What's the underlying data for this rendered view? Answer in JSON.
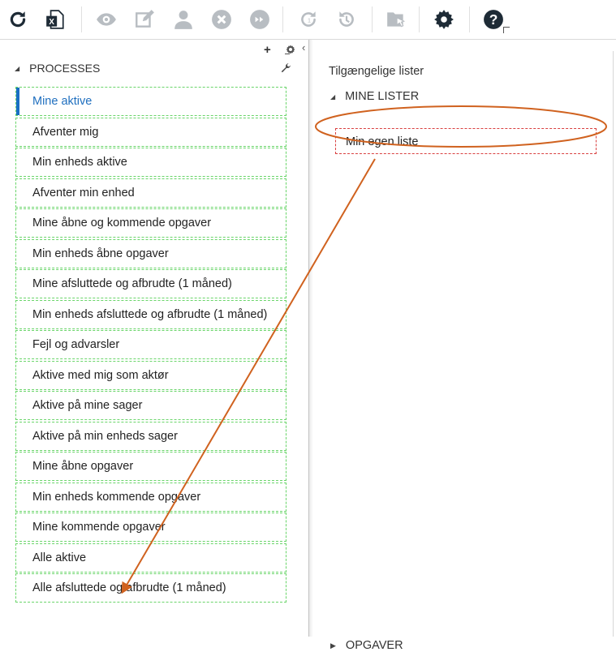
{
  "toolbar": {
    "icons": [
      {
        "name": "refresh-icon",
        "enabled": true
      },
      {
        "name": "excel-export-icon",
        "enabled": true
      },
      {
        "name": "view-icon",
        "enabled": false
      },
      {
        "name": "edit-icon",
        "enabled": false
      },
      {
        "name": "user-icon",
        "enabled": false
      },
      {
        "name": "cancel-icon",
        "enabled": false
      },
      {
        "name": "skip-icon",
        "enabled": false
      },
      {
        "name": "restart-icon",
        "enabled": false
      },
      {
        "name": "history-icon",
        "enabled": false
      },
      {
        "name": "move-document-icon",
        "enabled": false
      },
      {
        "name": "gear-icon",
        "enabled": true
      },
      {
        "name": "help-icon",
        "enabled": true
      }
    ],
    "colors": {
      "enabled": "#1e2b36",
      "disabled": "#b8bdc2"
    }
  },
  "left_panel": {
    "section_label": "PROCESSES",
    "items": [
      {
        "label": "Mine aktive",
        "active": true
      },
      {
        "label": "Afventer mig"
      },
      {
        "label": "Min enheds aktive"
      },
      {
        "label": "Afventer min enhed"
      },
      {
        "label": "Mine åbne og kommende opgaver"
      },
      {
        "label": "Min enheds åbne opgaver"
      },
      {
        "label": "Mine afsluttede og afbrudte (1 måned)"
      },
      {
        "label": "Min enheds afsluttede og afbrudte (1 måned)"
      },
      {
        "label": "Fejl og advarsler"
      },
      {
        "label": "Aktive med mig som aktør"
      },
      {
        "label": "Aktive på mine sager"
      },
      {
        "label": "Aktive på min enheds sager"
      },
      {
        "label": "Mine åbne opgaver"
      },
      {
        "label": "Min enheds kommende opgaver"
      },
      {
        "label": "Mine kommende opgaver"
      },
      {
        "label": "Alle aktive"
      },
      {
        "label": "Alle afsluttede og afbrudte (1 måned)"
      }
    ]
  },
  "right_panel": {
    "title": "Tilgængelige lister",
    "mine_lister": {
      "label": "MINE LISTER",
      "items": [
        {
          "label": "Min egen liste"
        }
      ]
    },
    "opgaver": {
      "label": "OPGAVER"
    }
  },
  "annotation": {
    "color": "#d0621f"
  }
}
